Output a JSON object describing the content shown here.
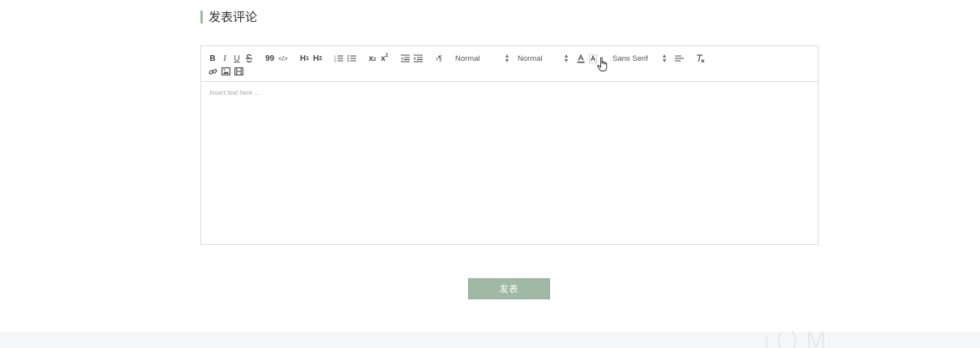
{
  "section": {
    "title": "发表评论"
  },
  "editor": {
    "toolbar": {
      "bold": "B",
      "italic": "I",
      "underline": "U",
      "strike": "S",
      "blockquote": "99",
      "code": "</>",
      "h1": {
        "main": "H",
        "sub": "1"
      },
      "h2": {
        "main": "H",
        "sub": "2"
      },
      "subscript": {
        "main": "x",
        "sub": "2"
      },
      "superscript": {
        "main": "x",
        "sup": "2"
      },
      "direction": "›¶",
      "size_picker": "Normal",
      "header_picker": "Normal",
      "font_picker": "Sans Serif"
    },
    "placeholder": "Insert text here ..."
  },
  "submit": {
    "label": "发表"
  },
  "footer": {
    "logo": "iQM"
  },
  "colors": {
    "accent": "#9fb9a5",
    "border": "#dcdcdc",
    "footer_bg": "#f5f6f8"
  }
}
